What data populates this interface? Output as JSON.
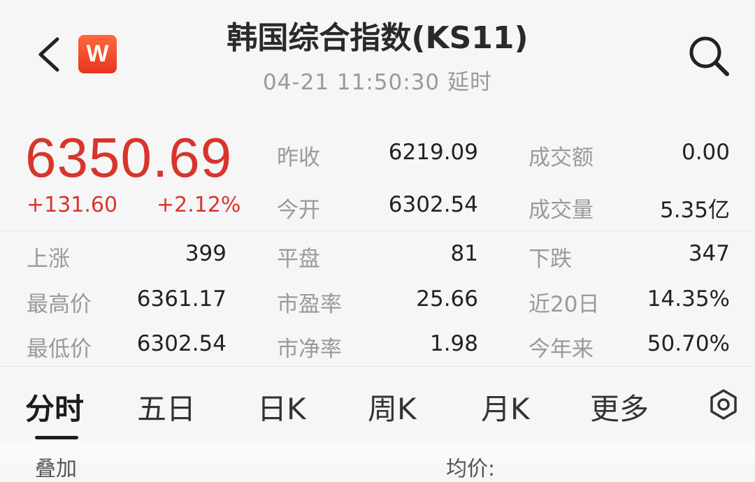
{
  "header": {
    "title": "韩国综合指数(KS11)",
    "subtitle": "04-21 11:50:30 延时",
    "logo_text": "W",
    "back_icon": "chevron-left-icon",
    "search_icon": "search-icon"
  },
  "quote": {
    "price": "6350.69",
    "change": "+131.60",
    "change_pct": "+2.12%",
    "up_color": "#d9342b"
  },
  "stats_top": [
    {
      "label": "昨收",
      "value": "6219.09"
    },
    {
      "label": "成交额",
      "value": "0.00"
    },
    {
      "label": "今开",
      "value": "6302.54"
    },
    {
      "label": "成交量",
      "value": "5.35亿"
    }
  ],
  "stats_grid": [
    {
      "label": "上涨",
      "value": "399"
    },
    {
      "label": "平盘",
      "value": "81"
    },
    {
      "label": "下跌",
      "value": "347"
    },
    {
      "label": "最高价",
      "value": "6361.17"
    },
    {
      "label": "市盈率",
      "value": "25.66"
    },
    {
      "label": "近20日",
      "value": "14.35%"
    },
    {
      "label": "最低价",
      "value": "6302.54"
    },
    {
      "label": "市净率",
      "value": "1.98"
    },
    {
      "label": "今年来",
      "value": "50.70%"
    }
  ],
  "tabs": [
    {
      "label": "分时",
      "active": true
    },
    {
      "label": "五日"
    },
    {
      "label": "日K"
    },
    {
      "label": "周K"
    },
    {
      "label": "月K"
    },
    {
      "label": "更多"
    }
  ],
  "settings_icon": "settings-hexagon-icon",
  "bottom": {
    "left_label": "叠加",
    "right_label": "均价:"
  }
}
